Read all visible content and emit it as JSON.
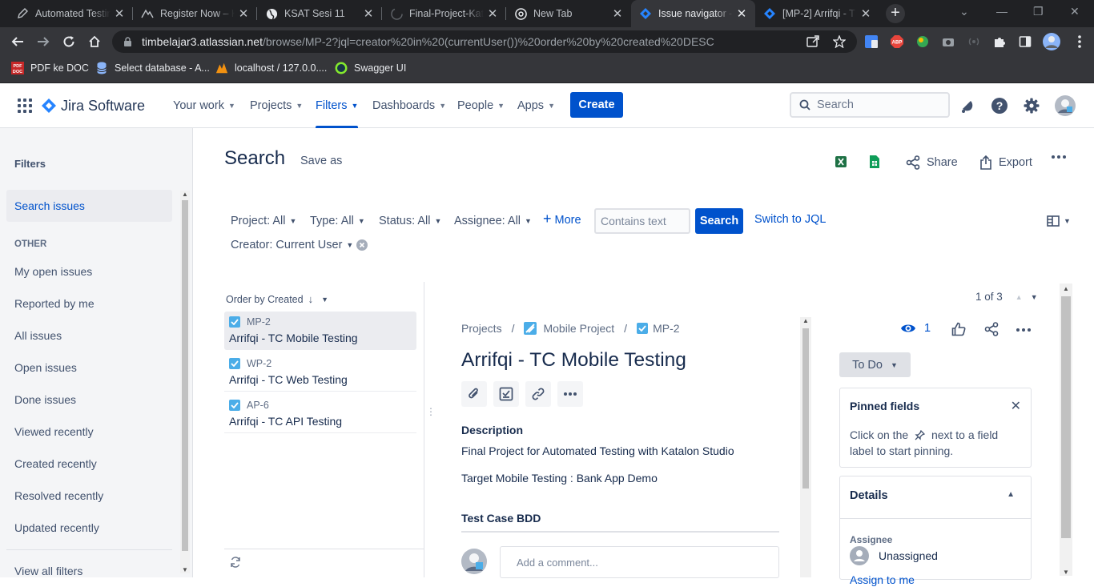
{
  "browser": {
    "tabs": [
      {
        "title": "Automated Testing",
        "icon": "pen-icon"
      },
      {
        "title": "Register Now – K",
        "icon": "katalon-icon"
      },
      {
        "title": "KSAT Sesi 11",
        "icon": "globe-icon"
      },
      {
        "title": "Final-Project-Kat",
        "icon": "github-icon"
      },
      {
        "title": "New Tab",
        "icon": "chrome-icon"
      },
      {
        "title": "Issue navigator -",
        "icon": "jira-icon",
        "active": true
      },
      {
        "title": "[MP-2] Arrifqi - T",
        "icon": "jira-icon"
      }
    ],
    "url_host": "timbelajar3.atlassian.net",
    "url_path": "/browse/MP-2?jql=creator%20in%20(currentUser())%20order%20by%20created%20DESC",
    "bookmarks": [
      {
        "label": "PDF ke DOC",
        "icon": "pdf-doc-icon"
      },
      {
        "label": "Select database - A...",
        "icon": "database-icon"
      },
      {
        "label": "localhost / 127.0.0....",
        "icon": "phpmyadmin-icon"
      },
      {
        "label": "Swagger UI",
        "icon": "swagger-icon"
      }
    ]
  },
  "jira": {
    "product": "Jira Software",
    "nav": [
      {
        "label": "Your work"
      },
      {
        "label": "Projects"
      },
      {
        "label": "Filters",
        "active": true
      },
      {
        "label": "Dashboards"
      },
      {
        "label": "People"
      },
      {
        "label": "Apps"
      }
    ],
    "create_label": "Create",
    "search_placeholder": "Search",
    "brand_color": "#0052cc"
  },
  "sidebar": {
    "heading": "Filters",
    "primary": "Search issues",
    "section_label": "OTHER",
    "items": [
      "My open issues",
      "Reported by me",
      "All issues",
      "Open issues",
      "Done issues",
      "Viewed recently",
      "Created recently",
      "Resolved recently",
      "Updated recently"
    ],
    "footer": "View all filters"
  },
  "search": {
    "title": "Search",
    "save_as": "Save as",
    "actions": {
      "share": "Share",
      "export": "Export"
    },
    "filters": {
      "project": "Project: All",
      "type": "Type: All",
      "status": "Status: All",
      "assignee": "Assignee: All",
      "more": "More",
      "contains_placeholder": "Contains text",
      "search_button": "Search",
      "switch_jql": "Switch to JQL",
      "creator": "Creator: Current User"
    },
    "order_by": "Order by Created",
    "issues": [
      {
        "key": "MP-2",
        "summary": "Arrifqi - TC Mobile Testing",
        "selected": true
      },
      {
        "key": "WP-2",
        "summary": "Arrifqi - TC Web Testing"
      },
      {
        "key": "AP-6",
        "summary": "Arrifqi - TC API Testing"
      }
    ]
  },
  "detail": {
    "pager": "1 of 3",
    "crumbs": {
      "projects": "Projects",
      "project": "Mobile Project",
      "key": "MP-2"
    },
    "title": "Arrifqi - TC Mobile Testing",
    "description_label": "Description",
    "description_lines": [
      "Final Project for Automated Testing with Katalon Studio",
      "Target Mobile Testing : Bank App Demo"
    ],
    "bdd_heading": "Test Case BDD",
    "comment_placeholder": "Add a comment...",
    "watch_count": "1",
    "status": "To Do",
    "pinned": {
      "title": "Pinned fields",
      "text_before": "Click on the",
      "text_after": "next to a field label to start pinning."
    },
    "details": {
      "heading": "Details",
      "assignee_label": "Assignee",
      "assignee_value": "Unassigned",
      "assign_me": "Assign to me"
    }
  }
}
